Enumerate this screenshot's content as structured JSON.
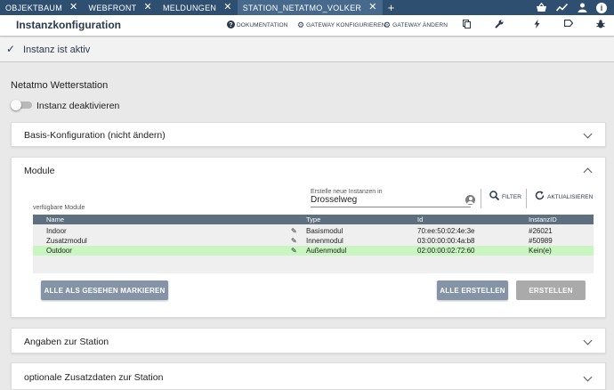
{
  "tabs": [
    {
      "label": "OBJEKTBAUM",
      "active": false
    },
    {
      "label": "WEBFRONT",
      "active": false
    },
    {
      "label": "MELDUNGEN",
      "active": false
    },
    {
      "label": "STATION_NETATMO_VOLKER",
      "active": true
    }
  ],
  "tab_close_glyph": "✕",
  "tab_add_glyph": "+",
  "top_icons": [
    "basket-icon",
    "activity-icon",
    "person-icon",
    "info-icon"
  ],
  "header": {
    "title": "Instanzkonfiguration",
    "documentation": "DOKUMENTATION",
    "configure_gateway": "GATEWAY KONFIGURIEREN",
    "change_gateway": "GATEWAY ÄNDERN",
    "icons": [
      "copy-icon",
      "wrench-icon",
      "flash-icon",
      "tag-icon",
      "bug-icon"
    ]
  },
  "status": {
    "text": "Instanz ist aktiv"
  },
  "instance": {
    "title": "Netatmo Wetterstation",
    "toggle_label": "Instanz deaktivieren",
    "toggle_on": false
  },
  "panels": {
    "basis": "Basis-Konfiguration (nicht ändern)",
    "module": "Module",
    "angaben": "Angaben zur Station",
    "optional": "optionale Zusatzdaten zur Station"
  },
  "module": {
    "create_label": "Erstelle neue Instanzen in",
    "create_value": "Drosselweg",
    "available_label": "verfügbare Module",
    "filter": "FILTER",
    "refresh": "AKTUALISIEREN",
    "columns": {
      "name": "Name",
      "type": "Type",
      "id": "Id",
      "instance": "InstanzID"
    },
    "rows": [
      {
        "name": "Indoor",
        "type": "Basismodul",
        "id": "70:ee:50:02:4e:3e",
        "instance": "#26021",
        "highlight": false
      },
      {
        "name": "Zusatzmodul",
        "type": "Innenmodul",
        "id": "03:00:00:00:4a:b8",
        "instance": "#50989",
        "highlight": false
      },
      {
        "name": "Outdoor",
        "type": "Außenmodul",
        "id": "02:00:00:02:72:60",
        "instance": "Kein(e)",
        "highlight": true
      }
    ],
    "buttons": {
      "mark_seen": "ALLE ALS GESEHEN MARKIEREN",
      "create_all": "ALLE ERSTELLEN",
      "create": "ERSTELLEN"
    }
  },
  "colors": {
    "tabbar": "#2f4f70",
    "tab_active": "#46698c",
    "table_header": "#5e6f80",
    "row_highlight": "#c8f5c0",
    "button": "#8494a6",
    "button_disabled": "#aaaaaa"
  }
}
